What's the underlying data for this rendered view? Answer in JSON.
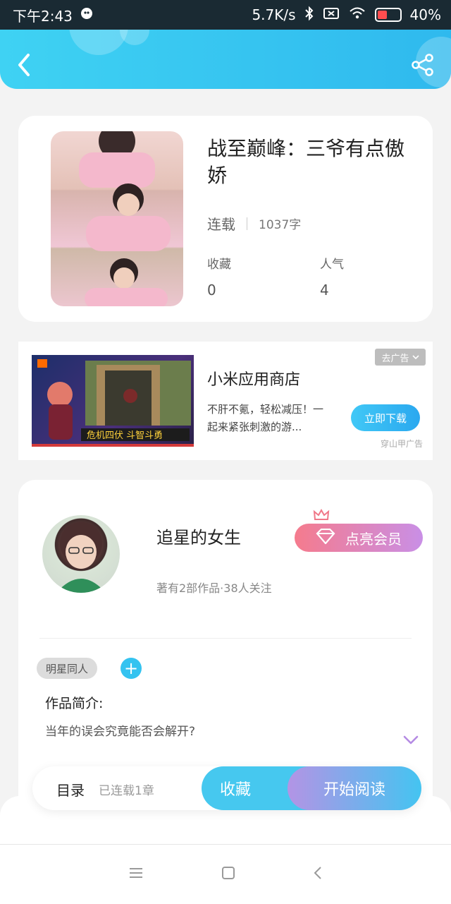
{
  "status_bar": {
    "time": "下午2:43",
    "net_speed": "5.7K/s",
    "battery_pct": "40%"
  },
  "book": {
    "title": "战至巅峰：三爷有点傲娇",
    "status": "连载",
    "word_count": "1037字",
    "favorites_label": "收藏",
    "favorites_value": "0",
    "popularity_label": "人气",
    "popularity_value": "4"
  },
  "ad": {
    "title": "小米应用商店",
    "description": "不肝不氪，轻松减压！一起来紧张刺激的游...",
    "close_label": "去广告",
    "download_label": "立即下载",
    "source": "穿山甲广告"
  },
  "author": {
    "name": "追星的女生",
    "meta": "著有2部作品·38人关注",
    "vip_label": "点亮会员",
    "tag": "明星同人",
    "intro_label": "作品简介:",
    "intro_text": "当年的误会究竟能否会解开?"
  },
  "actions": {
    "toc_label": "目录",
    "serial_label": "已连载1章",
    "favorite_label": "收藏",
    "read_label": "开始阅读"
  },
  "colors": {
    "accent": "#34c3f0",
    "vip": "#f57b8d"
  }
}
